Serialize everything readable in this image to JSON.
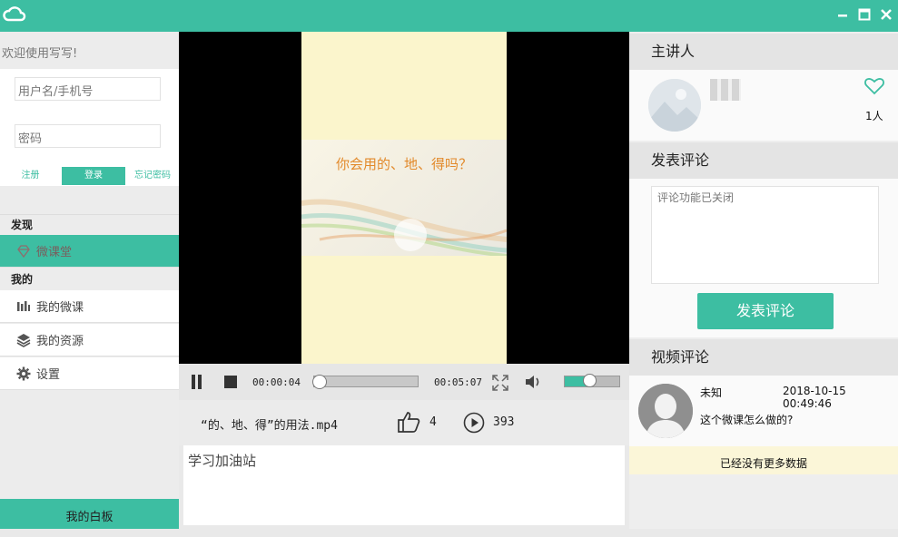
{
  "colors": {
    "accent": "#3dbea2",
    "note_bg": "#fbf6d8"
  },
  "window": {
    "logo_icon": "cloud-icon",
    "controls": [
      "minimize-icon",
      "maximize-icon",
      "close-icon"
    ]
  },
  "sidebar": {
    "welcome": "欢迎使用写写!",
    "username_placeholder": "用户名/手机号",
    "password_placeholder": "密码",
    "register": "注册",
    "login": "登录",
    "forgot": "忘记密码",
    "discover_head": "发现",
    "discover_items": [
      {
        "label": "微课堂",
        "icon": "diamond-icon"
      }
    ],
    "mine_head": "我的",
    "mine_items": [
      {
        "label": "我的微课",
        "icon": "chart-bars-icon"
      },
      {
        "label": "我的资源",
        "icon": "layers-icon"
      },
      {
        "label": "设置",
        "icon": "gear-icon"
      }
    ],
    "whiteboard": "我的白板"
  },
  "player": {
    "slide_title": "你会用的、地、得吗？",
    "current_time": "00:00:04",
    "duration": "00:05:07",
    "progress": 0.01,
    "volume": 0.5,
    "filename": "“的、地、得”的用法.mp4",
    "likes": "4",
    "plays": "393",
    "description": "学习加油站"
  },
  "right": {
    "speaker_head": "主讲人",
    "follow_count": "1人",
    "post_head": "发表评论",
    "comment_placeholder": "评论功能已关闭",
    "post_button": "发表评论",
    "comments_head": "视频评论",
    "comments": [
      {
        "user": "未知",
        "time": "2018-10-15 00:49:46",
        "text": "这个微课怎么做的?"
      }
    ],
    "no_more": "已经没有更多数据"
  }
}
